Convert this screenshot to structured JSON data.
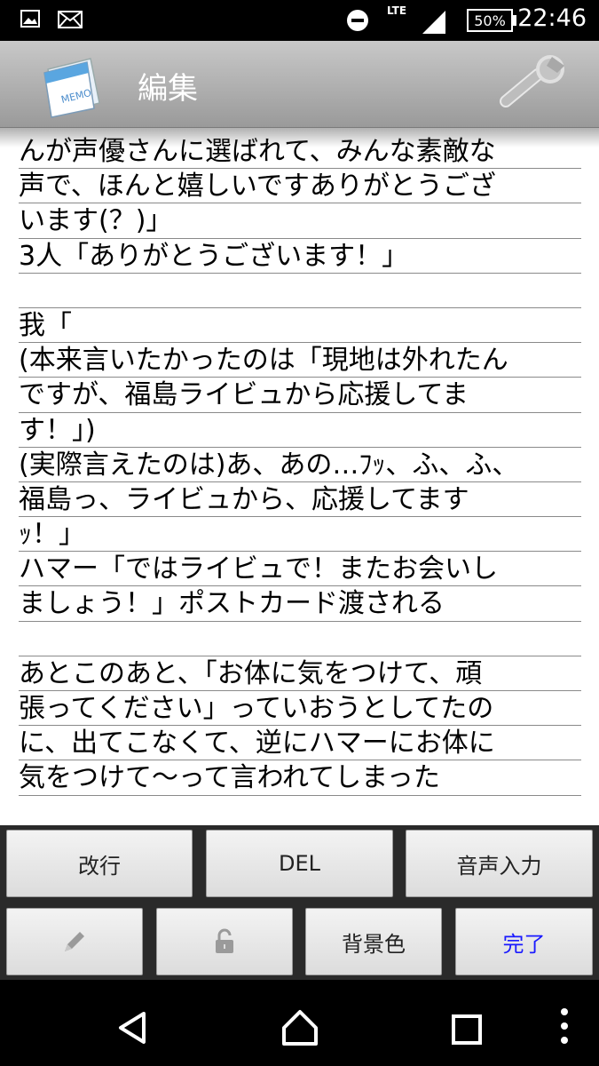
{
  "status_bar": {
    "time": "22:46",
    "battery": "50%",
    "network": "LTE",
    "icons": [
      "image-icon",
      "mail-icon",
      "do-not-disturb-icon",
      "signal-icon",
      "battery-icon"
    ]
  },
  "app_bar": {
    "title": "編集",
    "icons": [
      "memo-icon",
      "settings-wrench-icon"
    ]
  },
  "editor": {
    "lines": [
      "んが声優さんに選ばれて、みんな素敵な",
      "声で、ほんと嬉しいですありがとうござ",
      "います(？)」",
      "3人「ありがとうございます！」",
      "",
      "我「",
      "(本来言いたかったのは「現地は外れたん",
      "ですが、福島ライビュから応援してま",
      "す！」)",
      "(実際言えたのは)あ、あの…ﾌｯ、ふ、ふ、",
      "福島っ、ライビュから、応援してます",
      "ｯ！」",
      "ハマー「ではライビュで！またお会いし",
      "ましょう！」ポストカード渡される",
      "",
      "あとこのあと、「お体に気をつけて、頑",
      "張ってください」っていおうとしてたの",
      "に、出てこなくて、逆にハマーにお体に",
      "気をつけて～って言われてしまった"
    ]
  },
  "buttons": {
    "newline": "改行",
    "del": "DEL",
    "voice": "音声入力",
    "pen_icon": "pencil-icon",
    "lock_icon": "unlock-icon",
    "bgcolor": "背景色",
    "done": "完了",
    "done_color": "#1a1aff"
  },
  "nav_bar": {
    "icons": [
      "back-icon",
      "home-icon",
      "recents-icon",
      "overflow-icon"
    ]
  }
}
